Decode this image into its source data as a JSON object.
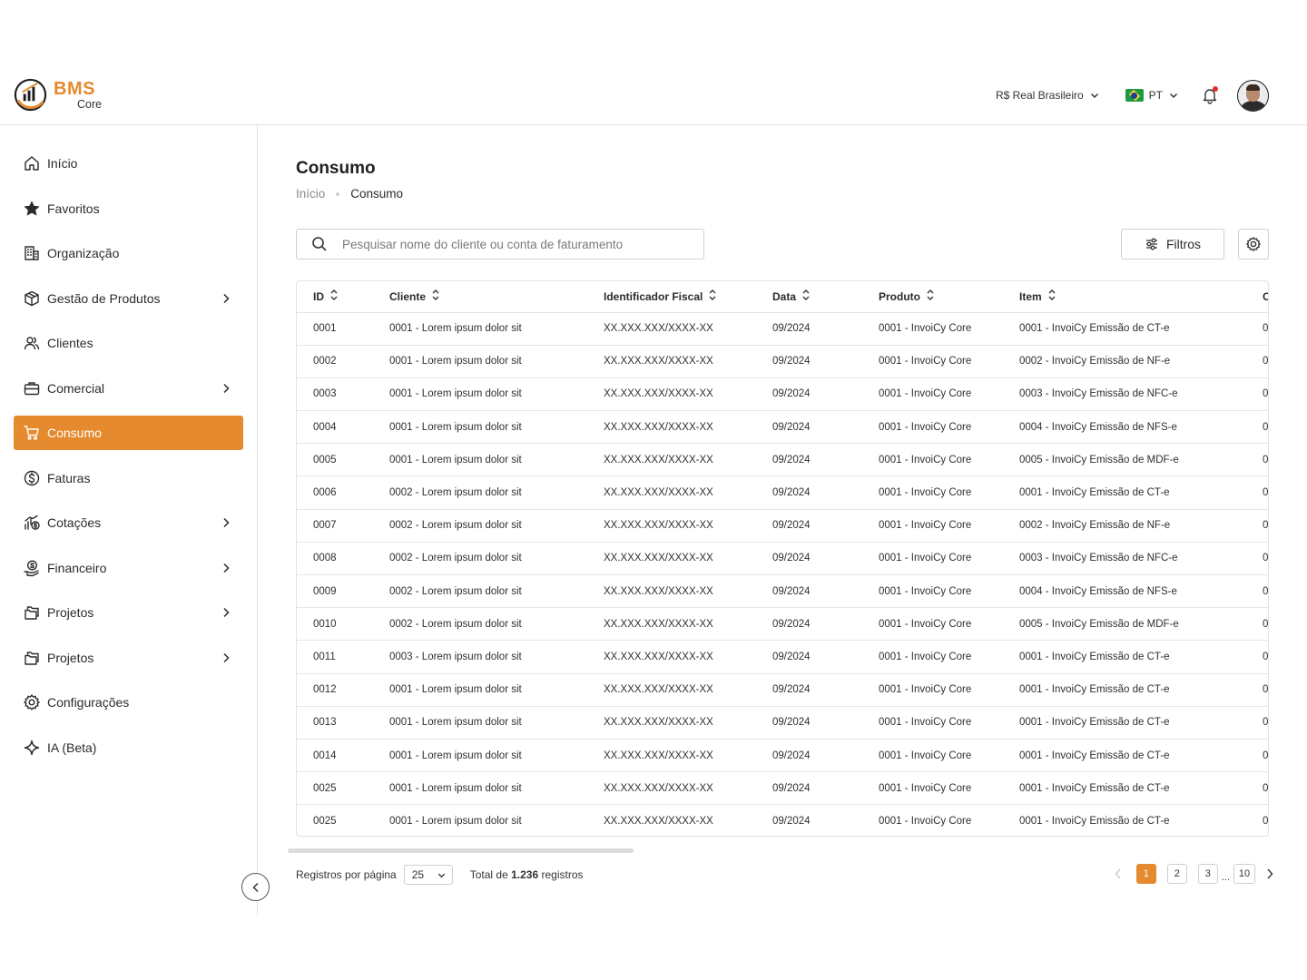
{
  "brand": {
    "title": "BMS",
    "subtitle": "Core",
    "color": "#e58a2e"
  },
  "header": {
    "currency": "R$ Real Brasileiro",
    "language": "PT"
  },
  "sidebar": {
    "items": [
      {
        "label": "Início",
        "icon": "home-icon",
        "expandable": false,
        "active": false
      },
      {
        "label": "Favoritos",
        "icon": "star-icon",
        "expandable": false,
        "active": false
      },
      {
        "label": "Organização",
        "icon": "building-icon",
        "expandable": false,
        "active": false
      },
      {
        "label": "Gestão de Produtos",
        "icon": "box-icon",
        "expandable": true,
        "active": false
      },
      {
        "label": "Clientes",
        "icon": "users-icon",
        "expandable": false,
        "active": false
      },
      {
        "label": "Comercial",
        "icon": "briefcase-icon",
        "expandable": true,
        "active": false
      },
      {
        "label": "Consumo",
        "icon": "cart-icon",
        "expandable": false,
        "active": true
      },
      {
        "label": "Faturas",
        "icon": "dollar-circle-icon",
        "expandable": false,
        "active": false
      },
      {
        "label": "Cotações",
        "icon": "chart-coin-icon",
        "expandable": true,
        "active": false
      },
      {
        "label": "Financeiro",
        "icon": "hand-coin-icon",
        "expandable": true,
        "active": false
      },
      {
        "label": "Projetos",
        "icon": "folders-icon",
        "expandable": true,
        "active": false
      },
      {
        "label": "Projetos",
        "icon": "folders-icon",
        "expandable": true,
        "active": false
      },
      {
        "label": "Configurações",
        "icon": "gear-icon",
        "expandable": false,
        "active": false
      },
      {
        "label": "IA (Beta)",
        "icon": "sparkle-icon",
        "expandable": false,
        "active": false
      }
    ]
  },
  "page": {
    "title": "Consumo",
    "breadcrumb": {
      "home": "Início",
      "current": "Consumo"
    }
  },
  "toolbar": {
    "search_placeholder": "Pesquisar nome do cliente ou conta de faturamento",
    "filters_label": "Filtros"
  },
  "table": {
    "columns": [
      "ID",
      "Cliente",
      "Identificador Fiscal",
      "Data",
      "Produto",
      "Item",
      "C"
    ],
    "rows": [
      [
        "0001",
        "0001 - Lorem ipsum dolor sit",
        "XX.XXX.XXX/XXXX-XX",
        "09/2024",
        "0001 - InvoiCy Core",
        "0001 - InvoiCy Emissão de CT-e",
        "0"
      ],
      [
        "0002",
        "0001 - Lorem ipsum dolor sit",
        "XX.XXX.XXX/XXXX-XX",
        "09/2024",
        "0001 - InvoiCy Core",
        "0002 - InvoiCy Emissão de NF-e",
        "0"
      ],
      [
        "0003",
        "0001 - Lorem ipsum dolor sit",
        "XX.XXX.XXX/XXXX-XX",
        "09/2024",
        "0001 - InvoiCy Core",
        "0003 - InvoiCy Emissão de NFC-e",
        "0"
      ],
      [
        "0004",
        "0001 - Lorem ipsum dolor sit",
        "XX.XXX.XXX/XXXX-XX",
        "09/2024",
        "0001 - InvoiCy Core",
        "0004 - InvoiCy Emissão de NFS-e",
        "0"
      ],
      [
        "0005",
        "0001 - Lorem ipsum dolor sit",
        "XX.XXX.XXX/XXXX-XX",
        "09/2024",
        "0001 - InvoiCy Core",
        "0005 - InvoiCy Emissão de MDF-e",
        "0"
      ],
      [
        "0006",
        "0002 - Lorem ipsum dolor sit",
        "XX.XXX.XXX/XXXX-XX",
        "09/2024",
        "0001 - InvoiCy Core",
        "0001 - InvoiCy Emissão de CT-e",
        "0"
      ],
      [
        "0007",
        "0002 - Lorem ipsum dolor sit",
        "XX.XXX.XXX/XXXX-XX",
        "09/2024",
        "0001 - InvoiCy Core",
        "0002 - InvoiCy Emissão de NF-e",
        "0"
      ],
      [
        "0008",
        "0002 - Lorem ipsum dolor sit",
        "XX.XXX.XXX/XXXX-XX",
        "09/2024",
        "0001 - InvoiCy Core",
        "0003 - InvoiCy Emissão de NFC-e",
        "0"
      ],
      [
        "0009",
        "0002 - Lorem ipsum dolor sit",
        "XX.XXX.XXX/XXXX-XX",
        "09/2024",
        "0001 - InvoiCy Core",
        "0004 - InvoiCy Emissão de NFS-e",
        "0"
      ],
      [
        "0010",
        "0002 - Lorem ipsum dolor sit",
        "XX.XXX.XXX/XXXX-XX",
        "09/2024",
        "0001 - InvoiCy Core",
        "0005 - InvoiCy Emissão de MDF-e",
        "0"
      ],
      [
        "0011",
        "0003 - Lorem ipsum dolor sit",
        "XX.XXX.XXX/XXXX-XX",
        "09/2024",
        "0001 - InvoiCy Core",
        "0001 - InvoiCy Emissão de CT-e",
        "0"
      ],
      [
        "0012",
        "0001 - Lorem ipsum dolor sit",
        "XX.XXX.XXX/XXXX-XX",
        "09/2024",
        "0001 - InvoiCy Core",
        "0001 - InvoiCy Emissão de CT-e",
        "0"
      ],
      [
        "0013",
        "0001 - Lorem ipsum dolor sit",
        "XX.XXX.XXX/XXXX-XX",
        "09/2024",
        "0001 - InvoiCy Core",
        "0001 - InvoiCy Emissão de CT-e",
        "0"
      ],
      [
        "0014",
        "0001 - Lorem ipsum dolor sit",
        "XX.XXX.XXX/XXXX-XX",
        "09/2024",
        "0001 - InvoiCy Core",
        "0001 - InvoiCy Emissão de CT-e",
        "0"
      ],
      [
        "0025",
        "0001 - Lorem ipsum dolor sit",
        "XX.XXX.XXX/XXXX-XX",
        "09/2024",
        "0001 - InvoiCy Core",
        "0001 - InvoiCy Emissão de CT-e",
        "0"
      ],
      [
        "0025",
        "0001 - Lorem ipsum dolor sit",
        "XX.XXX.XXX/XXXX-XX",
        "09/2024",
        "0001 - InvoiCy Core",
        "0001 - InvoiCy Emissão de CT-e",
        "0"
      ]
    ]
  },
  "footer": {
    "per_page_label": "Registros por página",
    "per_page_value": "25",
    "total_prefix": "Total de",
    "total_count": "1.236",
    "total_suffix": "registros"
  },
  "pagination": {
    "pages": [
      "1",
      "2",
      "3"
    ],
    "ellipsis": "...",
    "last_page": "10",
    "current": "1"
  }
}
